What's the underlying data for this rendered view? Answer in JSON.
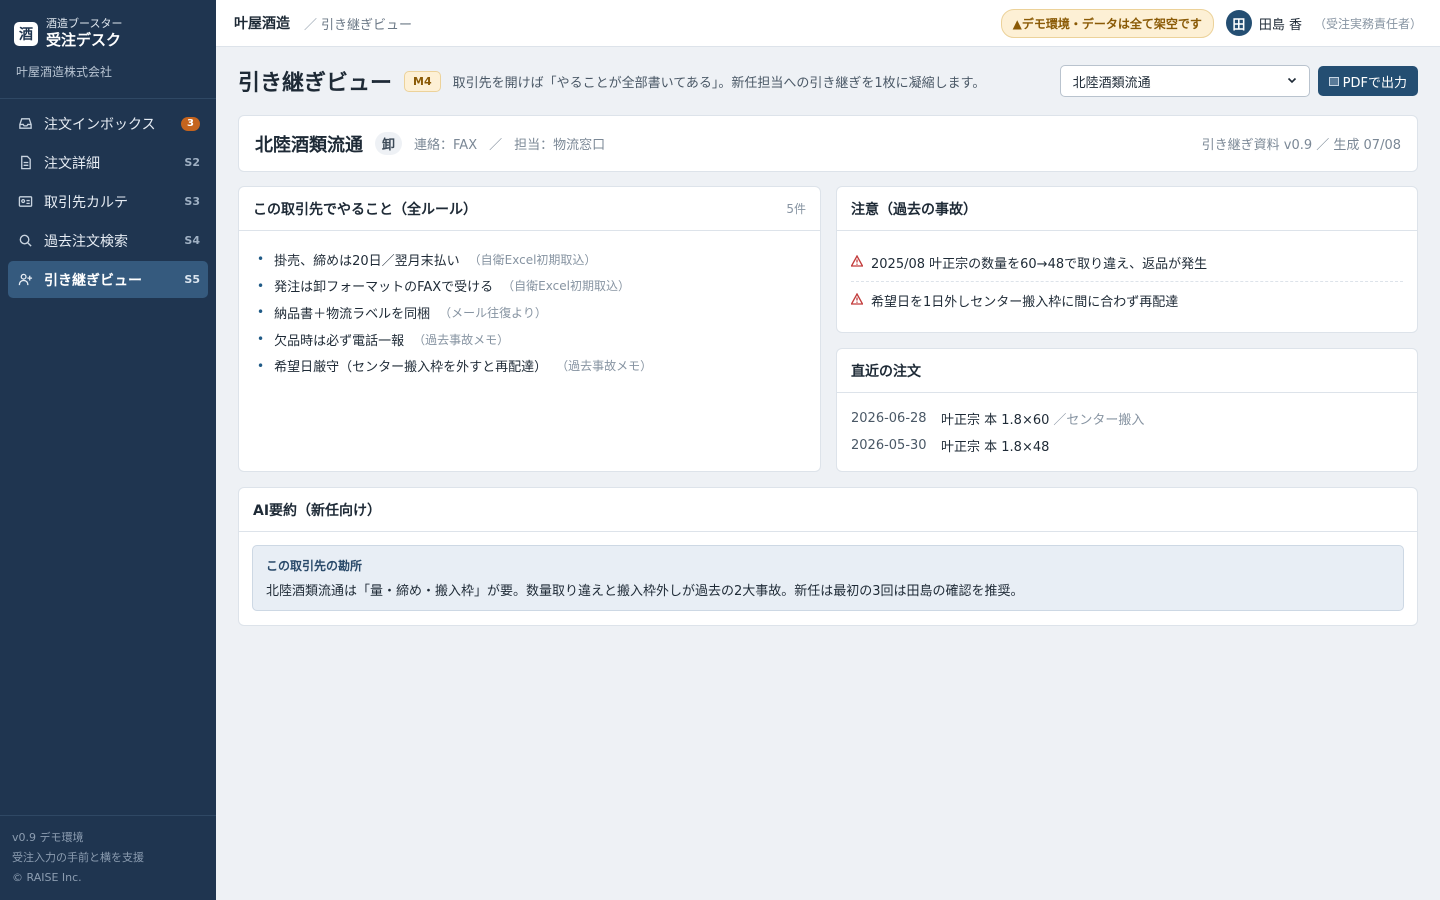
{
  "app": {
    "logo_char": "酒",
    "subtitle": "酒造ブースター",
    "title": "受注デスク",
    "company": "叶屋酒造株式会社"
  },
  "sidebar": {
    "items": [
      {
        "label": "注文インボックス",
        "key": "",
        "badge": "3",
        "icon": "inbox-icon"
      },
      {
        "label": "注文詳細",
        "key": "S2",
        "badge": "",
        "icon": "document-icon"
      },
      {
        "label": "取引先カルテ",
        "key": "S3",
        "badge": "",
        "icon": "id-card-icon"
      },
      {
        "label": "過去注文検索",
        "key": "S4",
        "badge": "",
        "icon": "search-icon"
      },
      {
        "label": "引き継ぎビュー",
        "key": "S5",
        "badge": "",
        "icon": "user-handover-icon"
      }
    ],
    "footer": [
      "v0.9 デモ環境",
      "受注入力の手前と横を支援",
      "© RAISE Inc."
    ]
  },
  "topbar": {
    "breadcrumb_main": "叶屋酒造",
    "breadcrumb_sep": "／",
    "breadcrumb_sub": "引き継ぎビュー",
    "demo_notice": "▲デモ環境・データは全て架空です",
    "avatar_char": "田",
    "user_name": "田島 香",
    "user_role": "（受注実務責任者）"
  },
  "page": {
    "title": "引き継ぎビュー",
    "badge": "M4",
    "description": "取引先を開けば「やることが全部書いてある」。新任担当への引き継ぎを1枚に凝縮します。",
    "selected_partner": "北陸酒類流通",
    "pdf_button": "PDFで出力"
  },
  "partner": {
    "name": "北陸酒類流通",
    "type_tag": "卸",
    "contact": "連絡：FAX",
    "sep": "／",
    "owner": "担当：物流窓口",
    "doc_info": "引き継ぎ資料 v0.9 ／ 生成 07/08"
  },
  "rules": {
    "title": "この取引先でやること（全ルール）",
    "count": "5件",
    "items": [
      {
        "text": "掛売、締めは20日／翌月末払い",
        "source": "（自衛Excel初期取込）"
      },
      {
        "text": "発注は卸フォーマットのFAXで受ける",
        "source": "（自衛Excel初期取込）"
      },
      {
        "text": "納品書＋物流ラベルを同梱",
        "source": "（メール往復より）"
      },
      {
        "text": "欠品時は必ず電話一報",
        "source": "（過去事故メモ）"
      },
      {
        "text": "希望日厳守（センター搬入枠を外すと再配達）",
        "source": "（過去事故メモ）"
      }
    ]
  },
  "warnings": {
    "title": "注意（過去の事故）",
    "items": [
      "2025/08 叶正宗の数量を60→48で取り違え、返品が発生",
      "希望日を1日外しセンター搬入枠に間に合わず再配達"
    ]
  },
  "orders": {
    "title": "直近の注文",
    "items": [
      {
        "date": "2026-06-28",
        "item": "叶正宗 本 1.8×60",
        "note": "／センター搬入"
      },
      {
        "date": "2026-05-30",
        "item": "叶正宗 本 1.8×48",
        "note": ""
      }
    ]
  },
  "ai_summary": {
    "title": "AI要約（新任向け）",
    "box_title": "この取引先の勘所",
    "text": "北陸酒類流通は「量・締め・搬入枠」が要。数量取り違えと搬入枠外しが過去の2大事故。新任は最初の3回は田島の確認を推奨。"
  },
  "colors": {
    "sidebar_bg": "#1f3550",
    "accent": "#244e72",
    "warning": "#c23b3b",
    "badge_orange": "#c5641e"
  }
}
